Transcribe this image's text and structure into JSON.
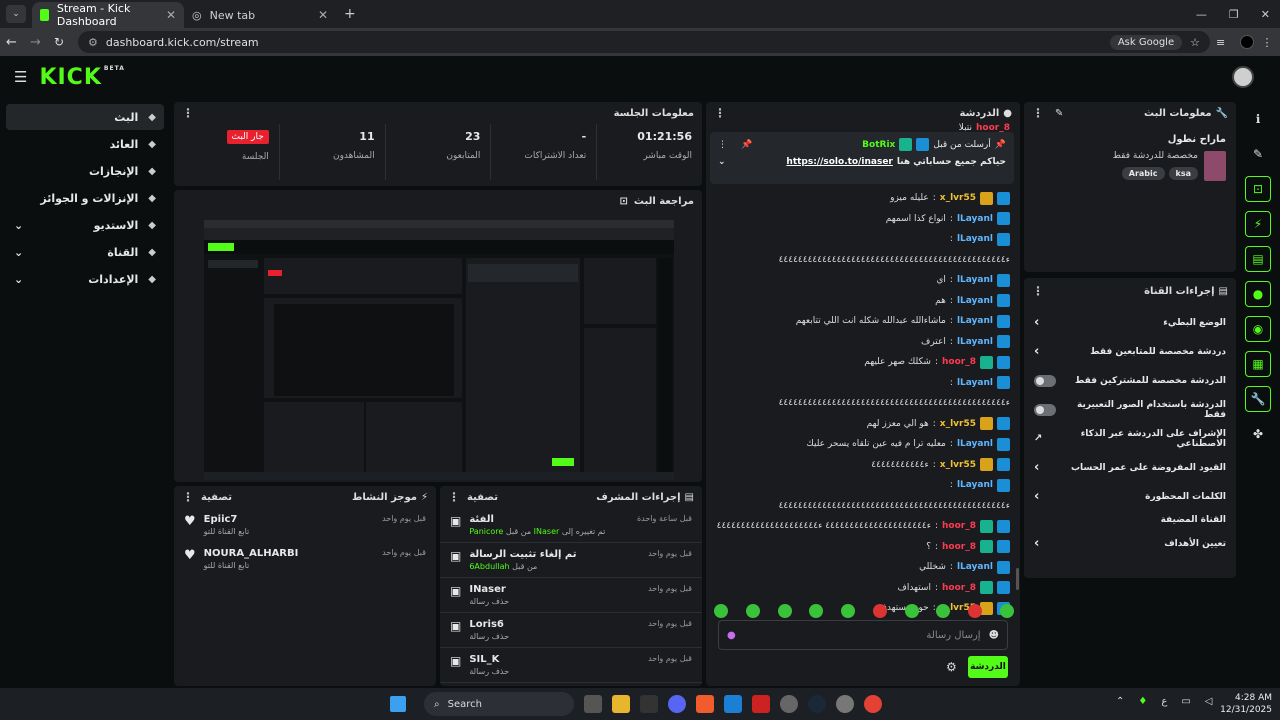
{
  "browser": {
    "tabs": [
      {
        "title": "Stream - Kick Dashboard",
        "active": true
      },
      {
        "title": "New tab",
        "active": false
      }
    ],
    "url": "dashboard.kick.com/stream",
    "ask_google": "Ask Google"
  },
  "logo": {
    "text": "KICK",
    "badge": "BETA"
  },
  "nav": [
    {
      "label": "البث",
      "active": true,
      "has_expand": false
    },
    {
      "label": "العائد",
      "active": false,
      "has_expand": false
    },
    {
      "label": "الإنجازات",
      "active": false,
      "has_expand": false
    },
    {
      "label": "الإنزالات و الجوائز",
      "active": false,
      "has_expand": false
    },
    {
      "label": "الاستديو",
      "active": false,
      "has_expand": true
    },
    {
      "label": "القناة",
      "active": false,
      "has_expand": true
    },
    {
      "label": "الإعدادات",
      "active": false,
      "has_expand": true
    }
  ],
  "session": {
    "title": "معلومات الجلسة",
    "stats": [
      {
        "value": "01:21:56",
        "label": "الوقت مباشر"
      },
      {
        "value": "-",
        "label": "تعداد الاشتراكات"
      },
      {
        "value": "23",
        "label": "المتابعون"
      },
      {
        "value": "11",
        "label": "المشاهدون"
      },
      {
        "value": "جار البث",
        "label": "الجلسة",
        "badge": true
      }
    ]
  },
  "preview": {
    "title": "مراجعة البث"
  },
  "activity": {
    "title": "موجز النشاط",
    "filter": "تصفية",
    "items": [
      {
        "user": "Epiic7",
        "desc": "تابع القناة للتو",
        "time": "قبل يوم واحد"
      },
      {
        "user": "NOURA_ALHARBI",
        "desc": "تابع القناة للتو",
        "time": "قبل يوم واحد"
      }
    ]
  },
  "modactions": {
    "title": "إجراءات المشرف",
    "filter": "تصفية",
    "items": [
      {
        "title": "الفئة",
        "prefix": "تم تغييره إلى",
        "actor": "INaser",
        "mid": "من قبل",
        "target": "Panicore",
        "time": "قبل ساعة واحدة"
      },
      {
        "title": "تم إلغاء تثبيت الرسالة",
        "prefix": "من قبل",
        "actor": "6Abdullah",
        "mid": "",
        "target": "",
        "time": "قبل يوم واحد"
      },
      {
        "title": "INaser",
        "prefix": "حذف رسالة",
        "actor": "",
        "mid": "",
        "target": "",
        "time": "قبل يوم واحد"
      },
      {
        "title": "Loris6",
        "prefix": "حذف رسالة",
        "actor": "",
        "mid": "",
        "target": "",
        "time": "قبل يوم واحد"
      },
      {
        "title": "SIL_K",
        "prefix": "حذف رسالة",
        "actor": "",
        "mid": "",
        "target": "",
        "time": "قبل يوم واحد"
      }
    ]
  },
  "chat": {
    "title": "الدردشة",
    "top_user": "hoor_8",
    "top_msg": "نتبلا",
    "pinned": {
      "label": "أرسلت من قبل",
      "user": "BotRix",
      "text": "حياكم جميع حساباتي هنا",
      "link": "https://solo.to/inaser"
    },
    "messages": [
      {
        "user": "x_lvr55",
        "color": "yel",
        "badges": [
          "b",
          "y"
        ],
        "msg": "عليله ميزو"
      },
      {
        "user": "lLayanl",
        "color": "blue",
        "badges": [
          "b"
        ],
        "msg": "انواع كذا اسمهم"
      },
      {
        "user": "lLayanl",
        "color": "blue",
        "badges": [
          "b"
        ],
        "msg": ""
      },
      {
        "user": "",
        "color": "",
        "badges": [],
        "msg": "ء٤٤٤٤٤٤٤٤٤٤٤٤٤٤٤٤٤٤٤٤٤٤٤٤٤٤٤٤٤٤٤٤٤٤٤٤٤٤٤٤٤٤٤٤٤٤٤"
      },
      {
        "user": "lLayanl",
        "color": "blue",
        "badges": [
          "b"
        ],
        "msg": "اي"
      },
      {
        "user": "lLayanl",
        "color": "blue",
        "badges": [
          "b"
        ],
        "msg": "هم"
      },
      {
        "user": "lLayanl",
        "color": "blue",
        "badges": [
          "b"
        ],
        "msg": "ماشاءالله عبدالله شكله انت اللي تتابعهم"
      },
      {
        "user": "lLayanl",
        "color": "blue",
        "badges": [
          "b"
        ],
        "msg": "اعترف"
      },
      {
        "user": "hoor_8",
        "color": "red",
        "badges": [
          "b",
          "g"
        ],
        "msg": "شكلك صهر عليهم"
      },
      {
        "user": "lLayanl",
        "color": "blue",
        "badges": [
          "b"
        ],
        "msg": ""
      },
      {
        "user": "",
        "color": "",
        "badges": [],
        "msg": "ء٤٤٤٤٤٤٤٤٤٤٤٤٤٤٤٤٤٤٤٤٤٤٤٤٤٤٤٤٤٤٤٤٤٤٤٤٤٤٤٤٤٤٤٤٤٤٤"
      },
      {
        "user": "x_lvr55",
        "color": "yel",
        "badges": [
          "b",
          "y"
        ],
        "msg": "هو الي معزز لهم"
      },
      {
        "user": "lLayanl",
        "color": "blue",
        "badges": [
          "b"
        ],
        "msg": "معليه ترا م فيه عين تلقاه يسحر عليك"
      },
      {
        "user": "x_lvr55",
        "color": "yel",
        "badges": [
          "b",
          "y"
        ],
        "msg": "ء٤٤٤٤٤٤٤٤٤٤٤"
      },
      {
        "user": "lLayanl",
        "color": "blue",
        "badges": [
          "b"
        ],
        "msg": ""
      },
      {
        "user": "",
        "color": "",
        "badges": [],
        "msg": "ء٤٤٤٤٤٤٤٤٤٤٤٤٤٤٤٤٤٤٤٤٤٤٤٤٤٤٤٤٤٤٤٤٤٤٤٤٤٤٤٤٤٤٤٤٤٤٤"
      },
      {
        "user": "hoor_8",
        "color": "red",
        "badges": [
          "b",
          "g"
        ],
        "msg": "ء٤٤٤٤٤٤٤٤٤٤٤٤٤٤٤٤٤٤٤٤٤ ء٤٤٤٤٤٤٤٤٤٤٤٤٤٤٤٤٤٤٤٤٤"
      },
      {
        "user": "hoor_8",
        "color": "red",
        "badges": [
          "b",
          "g"
        ],
        "msg": "؟"
      },
      {
        "user": "lLayanl",
        "color": "blue",
        "badges": [
          "b"
        ],
        "msg": "شخللي"
      },
      {
        "user": "hoor_8",
        "color": "red",
        "badges": [
          "b",
          "g"
        ],
        "msg": "استهداف"
      },
      {
        "user": "x_lvr55",
        "color": "yel",
        "badges": [
          "b",
          "y"
        ],
        "msg": "حور مستهدفة"
      }
    ],
    "input_placeholder": "إرسال رسالة",
    "send_label": "الدردشة"
  },
  "streaminfo": {
    "title": "معلومات البث",
    "stream_title": "ماراح نطول",
    "category": "مخصصة للدردشة فقط",
    "tags": [
      "ksa",
      "Arabic"
    ]
  },
  "channel": {
    "title": "إجراءات القناة",
    "rows": [
      {
        "label": "الوضع البطيء",
        "type": "arrow"
      },
      {
        "label": "دردشة مخصصة للمتابعين فقط",
        "type": "arrow"
      },
      {
        "label": "الدردشة مخصصة للمشتركين فقط",
        "type": "toggle"
      },
      {
        "label": "الدردشة باستخدام الصور التعبيرية فقط",
        "type": "toggle"
      },
      {
        "label": "الإشراف على الدردشة عبر الذكاء الاصطناعي",
        "type": "external"
      },
      {
        "label": "القيود المفروضة على عمر الحساب",
        "type": "arrow"
      },
      {
        "label": "الكلمات المحظورة",
        "type": "arrow"
      }
    ],
    "section": "القناة المضيفة",
    "target": "تعيين الأهداف"
  },
  "taskbar": {
    "search": "Search",
    "time": "4:28 AM",
    "date": "12/31/2025",
    "lang": "ع"
  }
}
